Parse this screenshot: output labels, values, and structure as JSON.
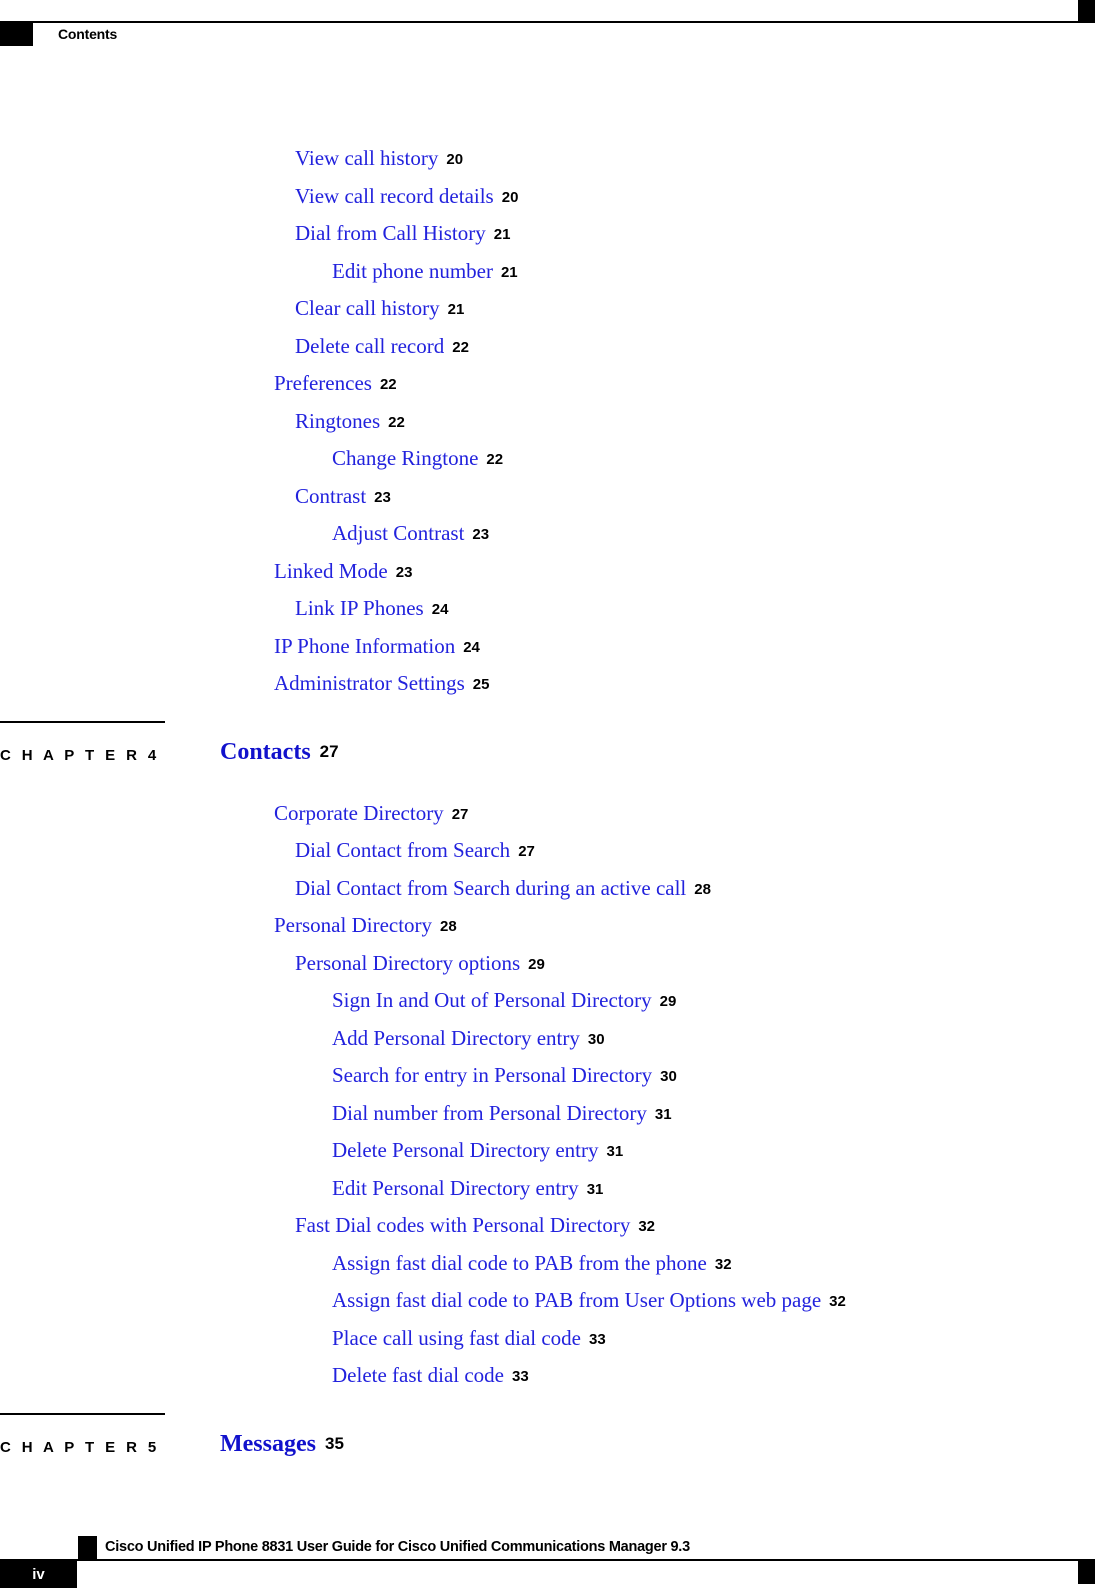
{
  "header": {
    "title": "Contents",
    "marker_icon": "black-square-marker"
  },
  "colors": {
    "link_blue": "#2222dd",
    "heading_blue": "#1111cc",
    "rule_black": "#000000",
    "page_background": "#ffffff"
  },
  "toc": {
    "continued_entries": [
      {
        "label": "View call history",
        "page": "20",
        "level": 2
      },
      {
        "label": "View call record details",
        "page": "20",
        "level": 2
      },
      {
        "label": "Dial from Call History",
        "page": "21",
        "level": 2
      },
      {
        "label": "Edit phone number",
        "page": "21",
        "level": 3
      },
      {
        "label": "Clear call history",
        "page": "21",
        "level": 2
      },
      {
        "label": "Delete call record",
        "page": "22",
        "level": 2
      },
      {
        "label": "Preferences",
        "page": "22",
        "level": 1
      },
      {
        "label": "Ringtones",
        "page": "22",
        "level": 2
      },
      {
        "label": "Change Ringtone",
        "page": "22",
        "level": 3
      },
      {
        "label": "Contrast",
        "page": "23",
        "level": 2
      },
      {
        "label": "Adjust Contrast",
        "page": "23",
        "level": 3
      },
      {
        "label": "Linked Mode",
        "page": "23",
        "level": 1
      },
      {
        "label": "Link IP Phones",
        "page": "24",
        "level": 2
      },
      {
        "label": "IP Phone Information",
        "page": "24",
        "level": 1
      },
      {
        "label": "Administrator Settings",
        "page": "25",
        "level": 1
      }
    ],
    "chapters": [
      {
        "chapter_label": "C H A P T E R  4",
        "title": "Contacts",
        "page": "27",
        "entries": [
          {
            "label": "Corporate Directory",
            "page": "27",
            "level": 1
          },
          {
            "label": "Dial Contact from Search",
            "page": "27",
            "level": 2
          },
          {
            "label": "Dial Contact from Search during an active call",
            "page": "28",
            "level": 2
          },
          {
            "label": "Personal Directory",
            "page": "28",
            "level": 1
          },
          {
            "label": "Personal Directory options",
            "page": "29",
            "level": 2
          },
          {
            "label": "Sign In and Out of Personal Directory",
            "page": "29",
            "level": 3
          },
          {
            "label": "Add Personal Directory entry",
            "page": "30",
            "level": 3
          },
          {
            "label": "Search for entry in Personal Directory",
            "page": "30",
            "level": 3
          },
          {
            "label": "Dial number from Personal Directory",
            "page": "31",
            "level": 3
          },
          {
            "label": "Delete Personal Directory entry",
            "page": "31",
            "level": 3
          },
          {
            "label": "Edit Personal Directory entry",
            "page": "31",
            "level": 3
          },
          {
            "label": "Fast Dial codes with Personal Directory",
            "page": "32",
            "level": 2
          },
          {
            "label": "Assign fast dial code to PAB from the phone",
            "page": "32",
            "level": 3
          },
          {
            "label": "Assign fast dial code to PAB from User Options web page",
            "page": "32",
            "level": 3
          },
          {
            "label": "Place call using fast dial code",
            "page": "33",
            "level": 3
          },
          {
            "label": "Delete fast dial code",
            "page": "33",
            "level": 3
          }
        ]
      },
      {
        "chapter_label": "C H A P T E R  5",
        "title": "Messages",
        "page": "35",
        "entries": []
      }
    ]
  },
  "footer": {
    "marker_icon": "black-square-marker",
    "book_title": "Cisco Unified IP Phone 8831 User Guide for Cisco Unified Communications Manager 9.3",
    "folio": "iv"
  }
}
